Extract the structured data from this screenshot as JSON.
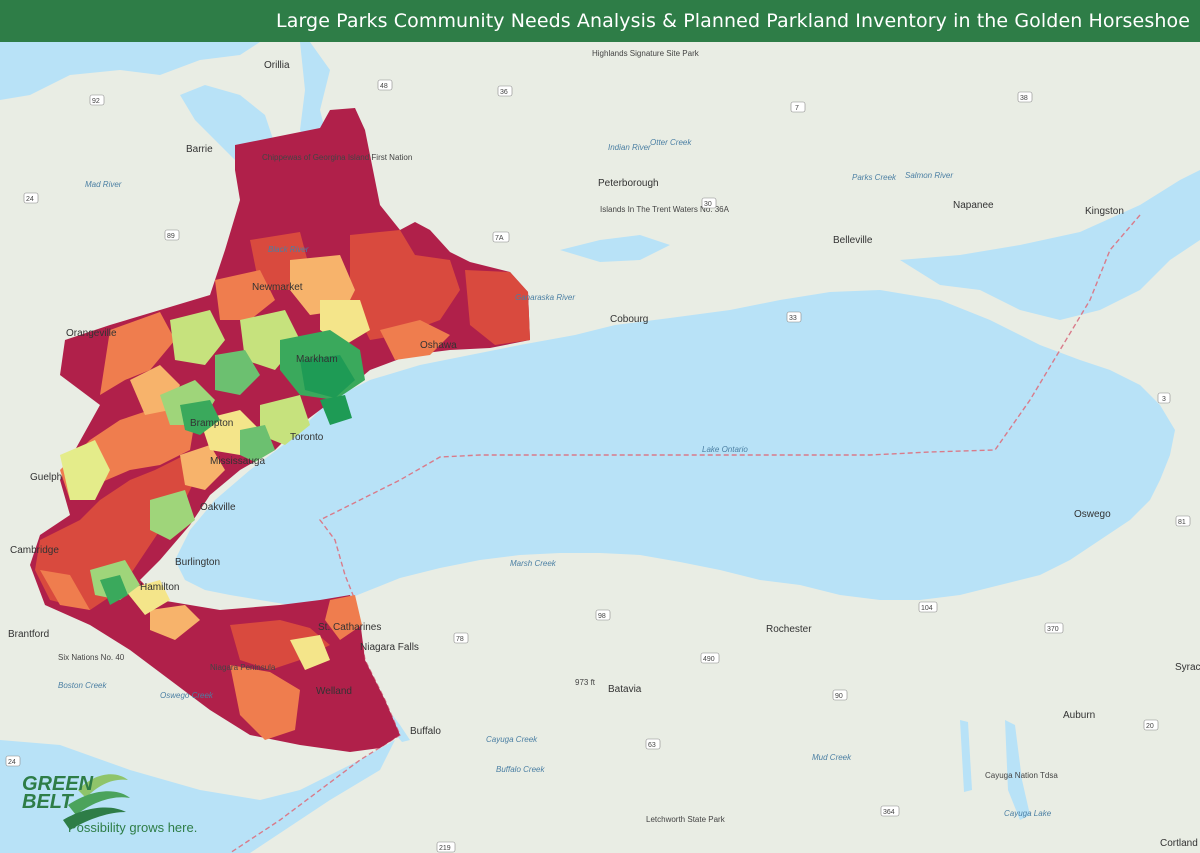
{
  "title": "Large Parks Community Needs Analysis & Planned Parkland Inventory in the Golden Horseshoe",
  "colors": {
    "title_bar": "#2e7d47",
    "water": "#b8e2f7",
    "land": "#e9ede4",
    "need_very_high": "#b0204a",
    "need_high": "#d94a3e",
    "need_medium_high": "#ef7d4e",
    "need_medium": "#f7b36b",
    "need_low_medium": "#f4e58a",
    "need_low": "#c6e27d",
    "need_very_low": "#6cc070",
    "need_lowest": "#1e9b55"
  },
  "places": [
    {
      "name": "Orillia"
    },
    {
      "name": "Barrie"
    },
    {
      "name": "Peterborough"
    },
    {
      "name": "Islands In The Trent Waters No. 36A"
    },
    {
      "name": "Highlands Signature Site Park"
    },
    {
      "name": "Napanee"
    },
    {
      "name": "Kingston"
    },
    {
      "name": "Belleville"
    },
    {
      "name": "Cobourg"
    },
    {
      "name": "Newmarket"
    },
    {
      "name": "Markham"
    },
    {
      "name": "Toronto"
    },
    {
      "name": "Mississauga"
    },
    {
      "name": "Brampton"
    },
    {
      "name": "Oakville"
    },
    {
      "name": "Burlington"
    },
    {
      "name": "Hamilton"
    },
    {
      "name": "Guelph"
    },
    {
      "name": "Cambridge"
    },
    {
      "name": "Brantford"
    },
    {
      "name": "Six Nations No. 40"
    },
    {
      "name": "St. Catharines"
    },
    {
      "name": "Niagara Falls"
    },
    {
      "name": "Niagara Peninsula"
    },
    {
      "name": "Welland"
    },
    {
      "name": "Buffalo"
    },
    {
      "name": "Batavia"
    },
    {
      "name": "Rochester"
    },
    {
      "name": "Oswego"
    },
    {
      "name": "Auburn"
    },
    {
      "name": "Syracuse"
    },
    {
      "name": "Cayuga Nation Tdsa"
    },
    {
      "name": "Letchworth State Park"
    },
    {
      "name": "Cortland"
    },
    {
      "name": "Oshawa"
    },
    {
      "name": "Orangeville"
    },
    {
      "name": "Chippewas of Georgina Island First Nation"
    }
  ],
  "water_labels": {
    "lake_ontario": "Lake Ontario",
    "mud_river": "Mad River",
    "oswego_creek": "Oswego Creek",
    "boston_creek": "Boston Creek",
    "marsh_creek": "Marsh Creek",
    "cayuga_creek": "Cayuga Creek",
    "buffalo_creek": "Buffalo Creek",
    "mud_creek": "Mud Creek",
    "cayuga_lake": "Cayuga Lake",
    "ganaraska_river": "Ganaraska River",
    "indian_river": "Indian River",
    "otter_creek": "Otter Creek",
    "parks_creek": "Parks Creek",
    "salmon_river": "Salmon River",
    "black_river": "Black River"
  },
  "highways": [
    "92",
    "48",
    "36",
    "7",
    "38",
    "24",
    "89",
    "7A",
    "30",
    "33",
    "3",
    "81",
    "104",
    "370",
    "98",
    "78",
    "490",
    "90",
    "63",
    "20",
    "219",
    "364",
    "24"
  ],
  "elevation": "973 ft",
  "logo": {
    "text_top": "GREEN",
    "text_bottom": "BELT",
    "tagline": "Possibility grows here."
  }
}
